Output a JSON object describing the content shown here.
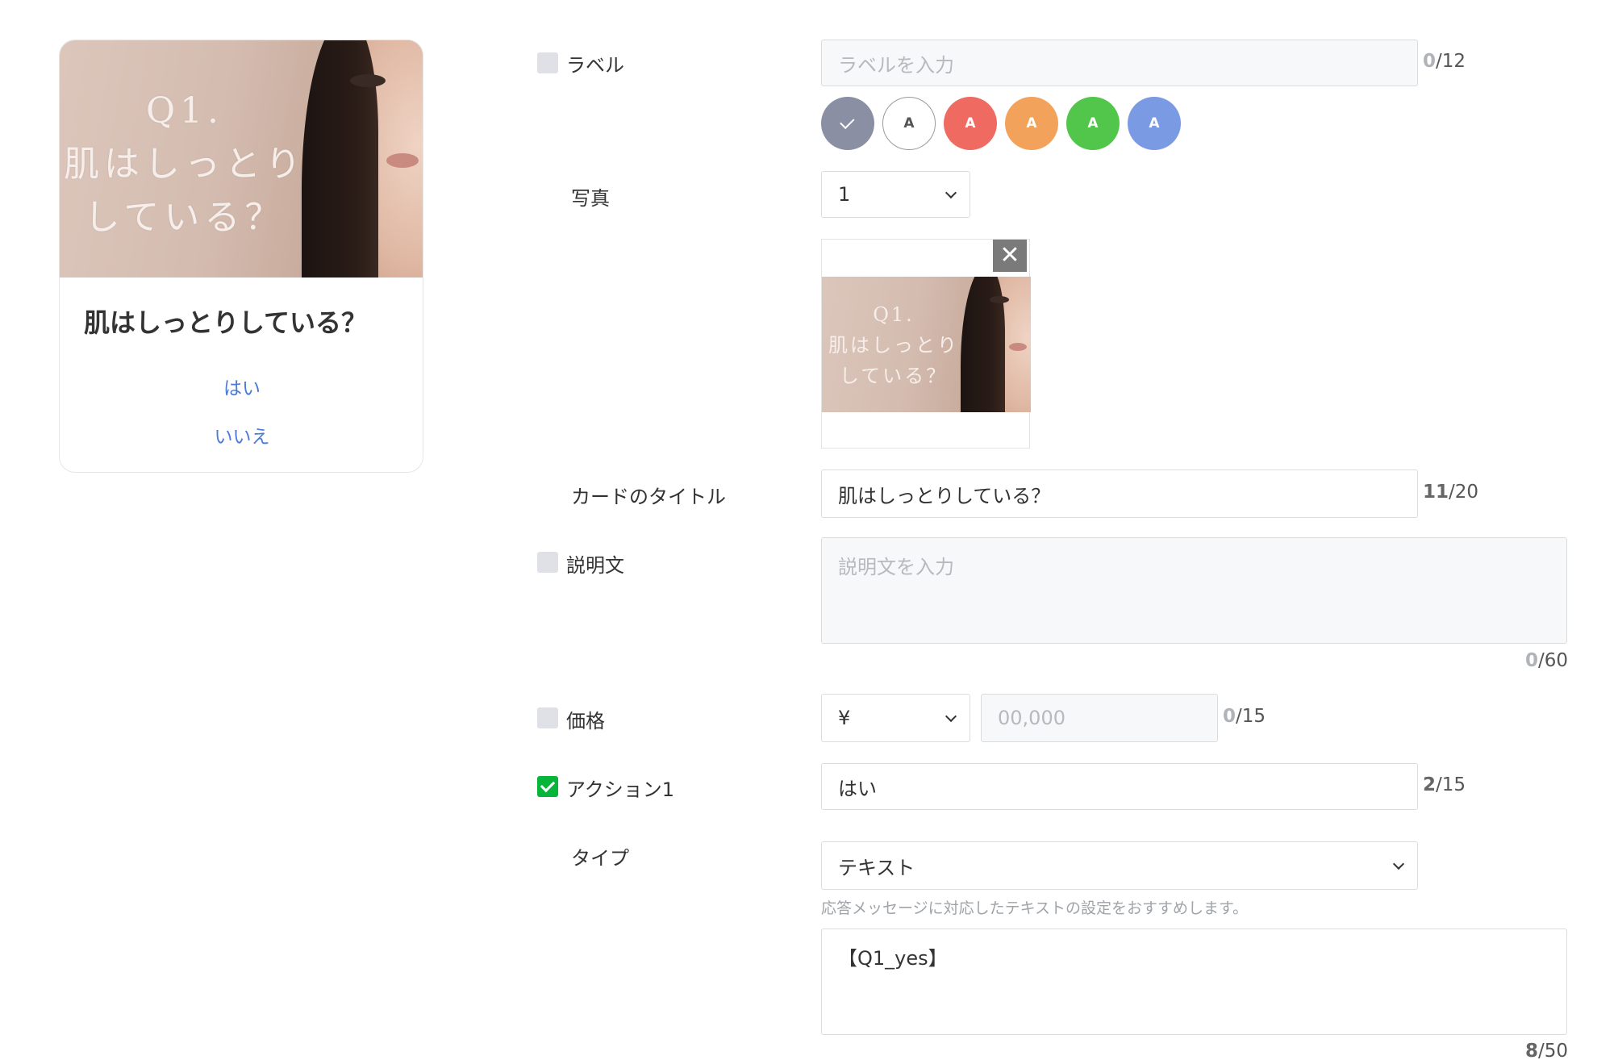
{
  "preview": {
    "hero_text": [
      "Q1.",
      "肌はしっとり",
      "している？"
    ],
    "title": "肌はしっとりしている？",
    "actions": [
      "はい",
      "いいえ"
    ]
  },
  "form": {
    "label": {
      "name": "ラベル",
      "checked": false,
      "placeholder": "ラベルを入力",
      "count": "0",
      "max": "/12"
    },
    "colors": [
      {
        "name": "gray",
        "value": "#8b8fa3",
        "text": "",
        "selected": true
      },
      {
        "name": "white",
        "value": "#ffffff",
        "text": "A",
        "selected": false
      },
      {
        "name": "red",
        "value": "#ef6b62",
        "text": "A",
        "selected": false
      },
      {
        "name": "orange",
        "value": "#f3a25c",
        "text": "A",
        "selected": false
      },
      {
        "name": "green",
        "value": "#52c64a",
        "text": "A",
        "selected": false
      },
      {
        "name": "blue",
        "value": "#7b9ae4",
        "text": "A",
        "selected": false
      }
    ],
    "photo": {
      "name": "写真",
      "select_value": "1",
      "close_glyph": "✕"
    },
    "card_title": {
      "name": "カードのタイトル",
      "value": "肌はしっとりしている？",
      "count": "11",
      "max": "/20"
    },
    "description": {
      "name": "説明文",
      "checked": false,
      "placeholder": "説明文を入力",
      "count": "0",
      "max": "/60"
    },
    "price": {
      "name": "価格",
      "checked": false,
      "currency": "¥",
      "placeholder": "00,000",
      "count": "0",
      "max": "/15"
    },
    "action1": {
      "name": "アクション1",
      "checked": true,
      "value": "はい",
      "count": "2",
      "max": "/15"
    },
    "type": {
      "name": "タイプ",
      "value": "テキスト",
      "hint": "応答メッセージに対応したテキストの設定をおすすめします。",
      "text": "【Q1_yes】",
      "count": "8",
      "max": "/50"
    }
  }
}
